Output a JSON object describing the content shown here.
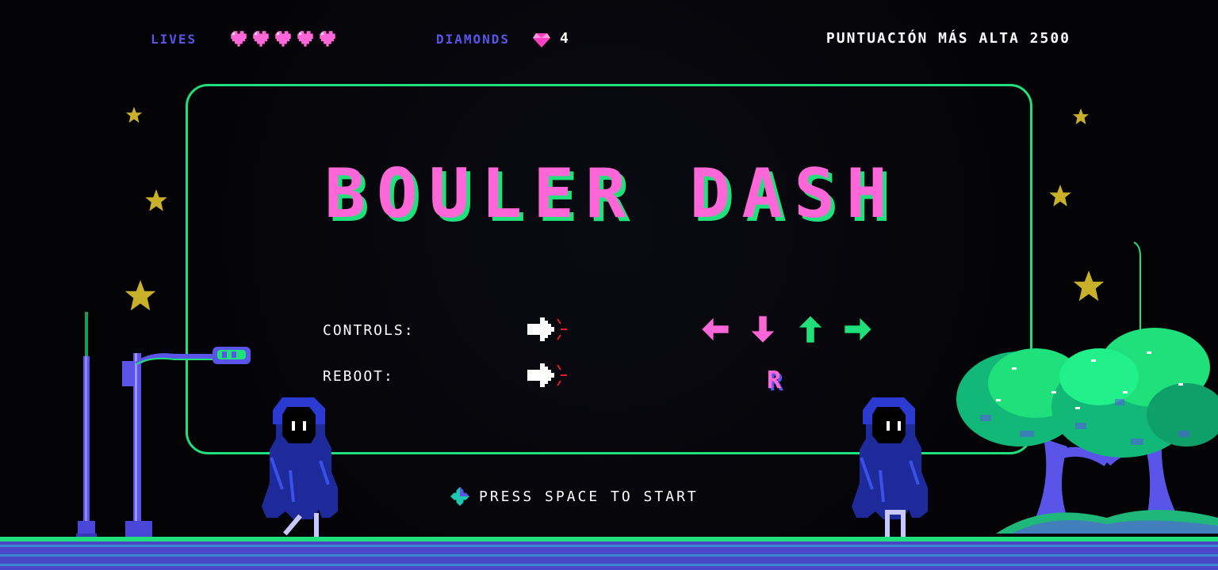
{
  "hud": {
    "lives_label": "LIVES",
    "lives_count": 5,
    "diamonds_label": "DIAMONDS",
    "diamonds_count": "4",
    "hiscore_text": "PUNTUACIÓN MÁS ALTA 2500"
  },
  "menu": {
    "title": "BOULER DASH",
    "controls_label": "CONTROLS:",
    "reboot_label": "REBOOT:",
    "control_arrows": [
      "arrow-left-icon",
      "arrow-down-icon",
      "arrow-up-icon",
      "arrow-right-icon"
    ],
    "reboot_key": "R",
    "start_prompt": "PRESS SPACE TO START"
  },
  "colors": {
    "pink": "#ff66d8",
    "green": "#1fe07a",
    "blue": "#5a55e8",
    "star": "#c9b02a"
  }
}
